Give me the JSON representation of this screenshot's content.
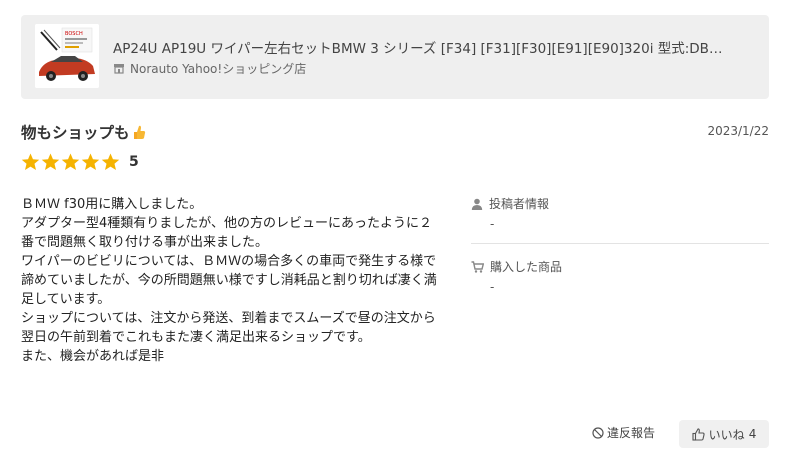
{
  "product": {
    "title": "AP24U AP19U ワイパー左右セットBMW 3 シリーズ [F34] [F31][F30][E91][E90]320i 型式:DB…",
    "store_name": "Norauto Yahoo!ショッピング店",
    "thumbnail_label": "BOSCH",
    "icons": {
      "store": "store-icon"
    }
  },
  "review": {
    "title": "物もショップも",
    "title_emoji": "👍",
    "date": "2023/1/22",
    "rating": 5,
    "rating_label": "5",
    "body": "ＢＭＷ f30用に購入しました。\nアダプター型4種類有りましたが、他の方のレビューにあったように２番で問題無く取り付ける事が出来ました。\nワイパーのビビリについては、ＢＭＷの場合多くの車両で発生する様で諦めていましたが、今の所問題無い様ですし消耗品と割り切れば凄く満足しています。\nショップについては、注文から発送、到着までスムーズで昼の注文から翌日の午前到着でこれもまた凄く満足出来るショップです。\nまた、機会があれば是非"
  },
  "meta": {
    "reviewer_label": "投稿者情報",
    "reviewer_value": "-",
    "purchased_label": "購入した商品",
    "purchased_value": "-"
  },
  "actions": {
    "report_label": "違反報告",
    "like_label": "いいね",
    "like_count": "4"
  },
  "colors": {
    "star": "#f5b301",
    "card_bg": "#efefef",
    "like_bg": "#f0f0f0"
  }
}
